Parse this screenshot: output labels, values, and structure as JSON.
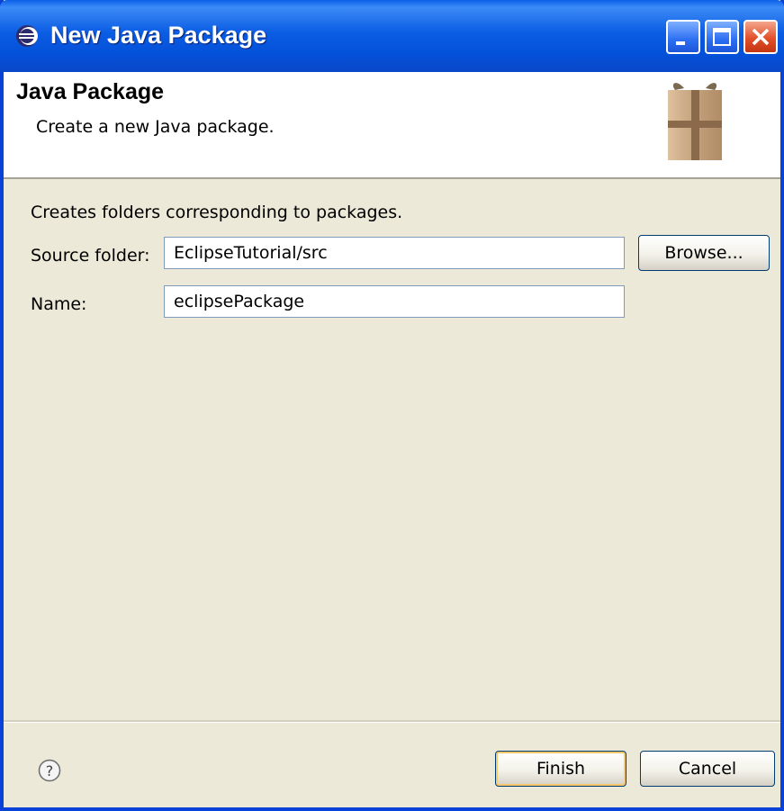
{
  "window": {
    "title": "New Java Package",
    "controls": {
      "minimize": "minimize",
      "maximize": "maximize",
      "close": "close"
    }
  },
  "header": {
    "title": "Java Package",
    "description": "Create a new Java package."
  },
  "form": {
    "intro": "Creates folders corresponding to packages.",
    "source_folder_label": "Source folder:",
    "source_folder_value": "EclipseTutorial/src",
    "name_label": "Name:",
    "name_value": "eclipsePackage",
    "browse_label": "Browse..."
  },
  "footer": {
    "finish_label": "Finish",
    "cancel_label": "Cancel"
  },
  "colors": {
    "titlebar": "#0a5fe6",
    "dialog_bg": "#ece9d8",
    "close_button": "#e2502b"
  },
  "icons": {
    "title": "eclipse-icon",
    "header": "package-icon",
    "help": "help-icon"
  }
}
